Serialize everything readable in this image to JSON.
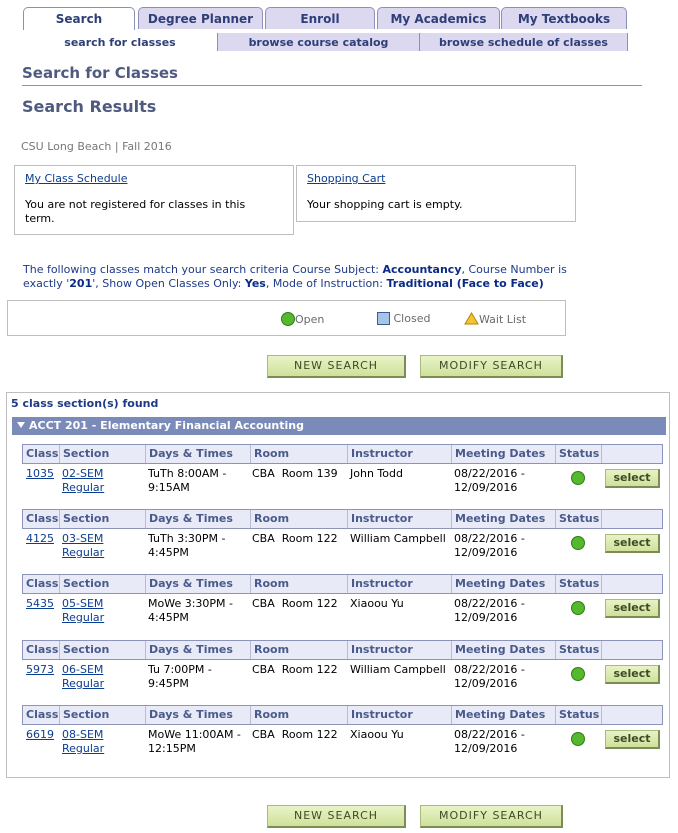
{
  "tabs": [
    {
      "label": "Search"
    },
    {
      "label": "Degree Planner"
    },
    {
      "label": "Enroll"
    },
    {
      "label": "My Academics"
    },
    {
      "label": "My Textbooks"
    }
  ],
  "subtabs": [
    {
      "label": "search for classes"
    },
    {
      "label": "browse course catalog"
    },
    {
      "label": "browse schedule of classes"
    }
  ],
  "page_title": "Search for Classes",
  "results_title": "Search Results",
  "term": "CSU Long Beach | Fall 2016",
  "schedule_box": {
    "link": "My Class Schedule",
    "text": "You are not registered for classes in this term."
  },
  "cart_box": {
    "link": "Shopping Cart",
    "text": "Your shopping cart is empty."
  },
  "criteria": {
    "p1": "The following classes match your search criteria Course Subject: ",
    "subject": "Accountancy",
    "p2": ",  Course Number is exactly '",
    "number": "201",
    "p3": "',  Show Open Classes Only: ",
    "open": "Yes",
    "p4": ",  Mode of Instruction: ",
    "mode": "Traditional (Face to Face)"
  },
  "legend": {
    "open": "Open",
    "closed": "Closed",
    "waitlist": "Wait List"
  },
  "buttons": {
    "new_search": "NEW SEARCH",
    "modify_search": "MODIFY SEARCH"
  },
  "found": "5 class section(s) found",
  "course_title": "ACCT 201 - Elementary Financial Accounting",
  "columns": {
    "class": "Class",
    "section": "Section",
    "days": "Days & Times",
    "room": "Room",
    "instructor": "Instructor",
    "dates": "Meeting Dates",
    "status": "Status"
  },
  "select_label": "select",
  "sections": [
    {
      "class": "1035",
      "section": "02-SEM",
      "component": "Regular",
      "days1": "TuTh 8:00AM -",
      "days2": "9:15AM",
      "room": "CBA  Room 139",
      "instructor": "John Todd",
      "date1": "08/22/2016 -",
      "date2": "12/09/2016",
      "status": "Open"
    },
    {
      "class": "4125",
      "section": "03-SEM",
      "component": "Regular",
      "days1": "TuTh 3:30PM -",
      "days2": "4:45PM",
      "room": "CBA  Room 122",
      "instructor": "William Campbell",
      "date1": "08/22/2016 -",
      "date2": "12/09/2016",
      "status": "Open"
    },
    {
      "class": "5435",
      "section": "05-SEM",
      "component": "Regular",
      "days1": "MoWe 3:30PM -",
      "days2": "4:45PM",
      "room": "CBA  Room 122",
      "instructor": "Xiaoou Yu",
      "date1": "08/22/2016 -",
      "date2": "12/09/2016",
      "status": "Open"
    },
    {
      "class": "5973",
      "section": "06-SEM",
      "component": "Regular",
      "days1": "Tu 7:00PM -",
      "days2": "9:45PM",
      "room": "CBA  Room 122",
      "instructor": "William Campbell",
      "date1": "08/22/2016 -",
      "date2": "12/09/2016",
      "status": "Open"
    },
    {
      "class": "6619",
      "section": "08-SEM",
      "component": "Regular",
      "days1": "MoWe 11:00AM -",
      "days2": "12:15PM",
      "room": "CBA  Room 122",
      "instructor": "Xiaoou Yu",
      "date1": "08/22/2016 -",
      "date2": "12/09/2016",
      "status": "Open"
    }
  ]
}
